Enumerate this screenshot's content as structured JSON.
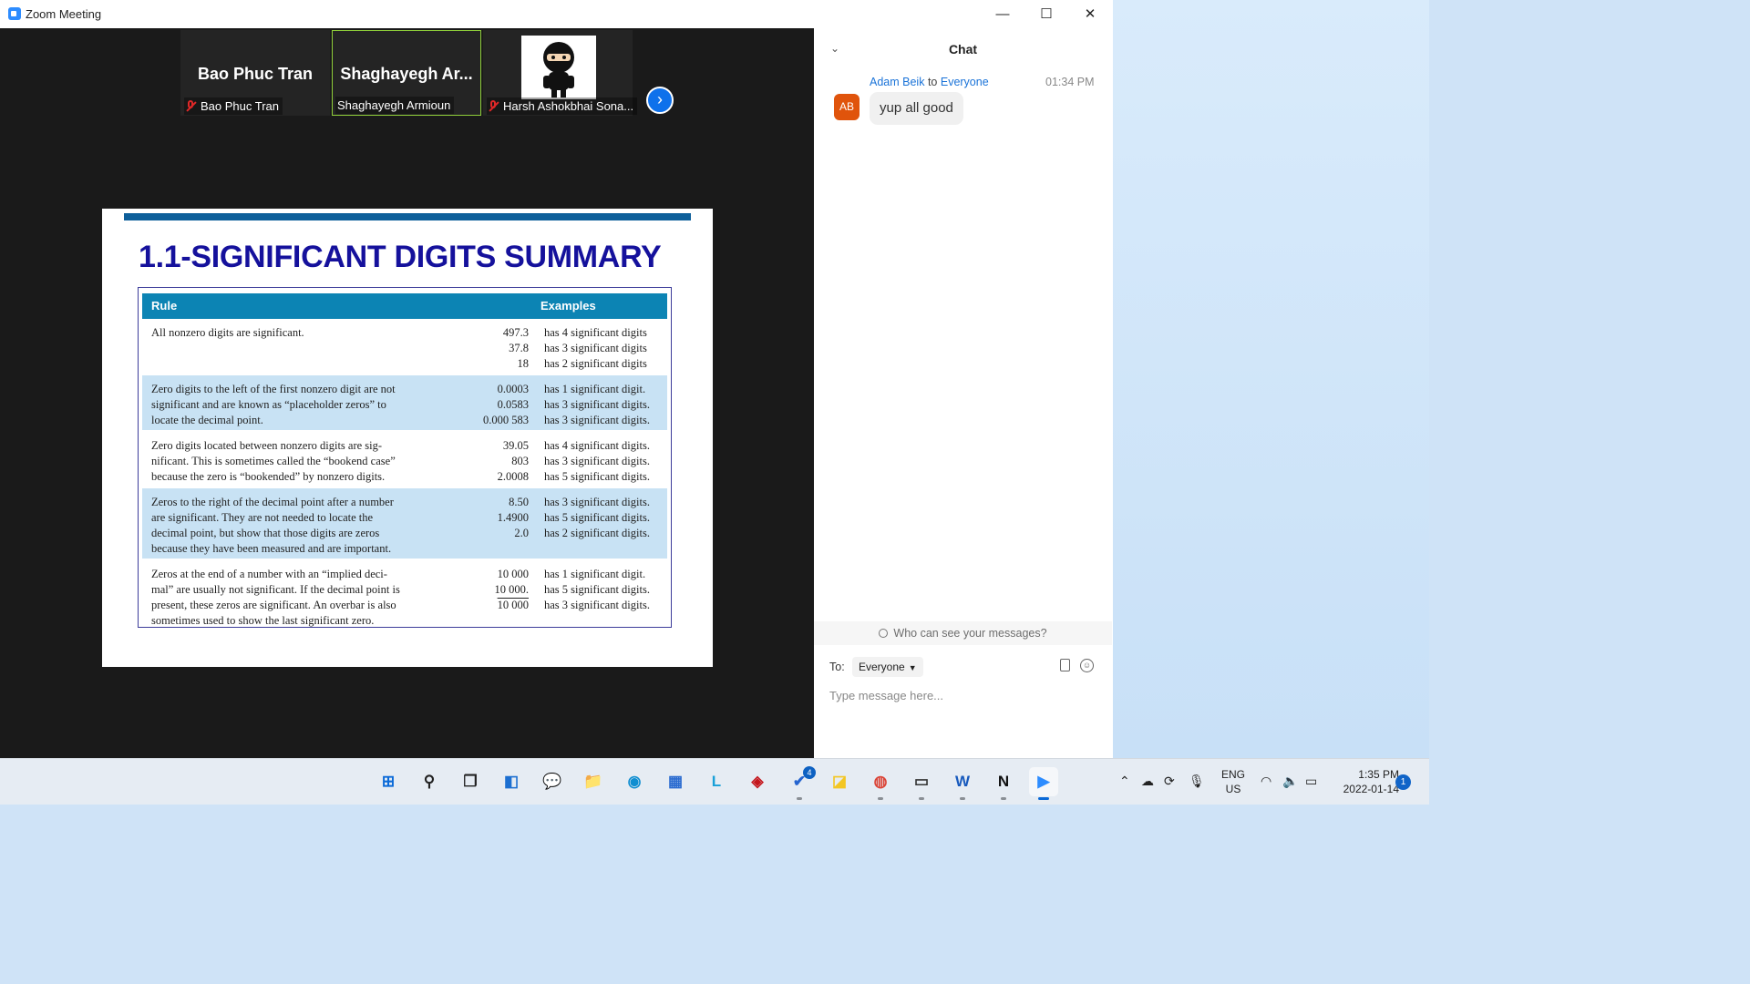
{
  "window": {
    "title": "Zoom Meeting",
    "controls": {
      "minimize": "—",
      "maximize": "☐",
      "close": "✕"
    }
  },
  "participants": [
    {
      "display": "Bao Phuc Tran",
      "name": "Bao Phuc Tran",
      "muted": true
    },
    {
      "display": "Shaghayegh  Ar...",
      "name": "Shaghayegh Armioun",
      "muted": false
    },
    {
      "display": "",
      "name": "Harsh Ashokbhai Sona...",
      "muted": true,
      "avatar": "ninja-avatar"
    }
  ],
  "next_icon": "›",
  "slide": {
    "title": "1.1-SIGNIFICANT DIGITS SUMMARY",
    "headers": {
      "rule": "Rule",
      "examples": "Examples"
    },
    "rows": [
      {
        "rule": [
          "All nonzero digits are significant."
        ],
        "nums": [
          "497.3",
          "37.8",
          "18"
        ],
        "examples": [
          "has 4 significant digits",
          "has 3 significant digits",
          "has 2 significant digits"
        ]
      },
      {
        "rule": [
          "Zero digits to the left of the first nonzero digit are not",
          "significant and are known as “placeholder zeros” to",
          "locate the decimal point."
        ],
        "nums": [
          "0.0003",
          "0.0583",
          "0.000 583"
        ],
        "examples": [
          "has 1 significant digit.",
          "has 3 significant digits.",
          "has 3 significant digits."
        ]
      },
      {
        "rule": [
          "Zero digits located between nonzero digits are sig-",
          "nificant. This is sometimes called the “bookend case”",
          "because the zero is “bookended” by nonzero digits."
        ],
        "nums": [
          "39.05",
          "803",
          "2.0008"
        ],
        "examples": [
          "has 4 significant digits.",
          "has 3 significant digits.",
          "has 5 significant digits."
        ]
      },
      {
        "rule": [
          "Zeros to the right of the decimal point after a number",
          "are significant. They are not needed to locate the",
          "decimal point, but show that those digits are zeros",
          "because they have been measured and are important."
        ],
        "nums": [
          "8.50",
          "1.4900",
          "2.0"
        ],
        "examples": [
          "has 3 significant digits.",
          "has 5 significant digits.",
          "has 2 significant digits."
        ]
      },
      {
        "rule": [
          "Zeros at the end of a number with an “implied deci-",
          "mal” are usually not significant. If the decimal point is",
          "present, these zeros are significant. An overbar is also",
          "sometimes used to show the last significant zero."
        ],
        "nums": [
          "10 000",
          "10 000.",
          "10 000"
        ],
        "examples": [
          "has 1 significant digit.",
          "has 5 significant digits.",
          "has 3 significant digits."
        ]
      }
    ]
  },
  "chat": {
    "title": "Chat",
    "collapse_icon": "⌄",
    "message": {
      "initials": "AB",
      "sender": "Adam Beik",
      "to_word": "to",
      "recipient": "Everyone",
      "time": "01:34 PM",
      "text": "yup all good"
    },
    "who_can_see": "Who can see your messages?",
    "to_label": "To:",
    "to_value": "Everyone",
    "input_placeholder": "Type message here..."
  },
  "taskbar": {
    "apps": [
      {
        "name": "windows-start-icon",
        "glyph": "⊞",
        "color": "#0b6ad8"
      },
      {
        "name": "search-icon",
        "glyph": "⚲",
        "color": "#222"
      },
      {
        "name": "task-view-icon",
        "glyph": "❐",
        "color": "#222"
      },
      {
        "name": "widgets-icon",
        "glyph": "◧",
        "color": "#1c6fd1"
      },
      {
        "name": "teams-chat-icon",
        "glyph": "💬",
        "color": "#5b5fc7"
      },
      {
        "name": "file-explorer-icon",
        "glyph": "📁",
        "color": "#e8b017"
      },
      {
        "name": "edge-icon",
        "glyph": "◉",
        "color": "#0f8ed1"
      },
      {
        "name": "store-icon",
        "glyph": "▦",
        "color": "#2a6bd0"
      },
      {
        "name": "l-app-icon",
        "glyph": "L",
        "color": "#19a0d8"
      },
      {
        "name": "mcafee-icon",
        "glyph": "◈",
        "color": "#c4161c"
      },
      {
        "name": "todo-icon",
        "glyph": "✔",
        "color": "#2564cf",
        "badge": "4"
      },
      {
        "name": "sticky-notes-icon",
        "glyph": "◪",
        "color": "#f3c623"
      },
      {
        "name": "chrome-icon",
        "glyph": "◍",
        "color": "#db4437"
      },
      {
        "name": "terminal-icon",
        "glyph": "▭",
        "color": "#333"
      },
      {
        "name": "word-icon",
        "glyph": "W",
        "color": "#185abd"
      },
      {
        "name": "notion-icon",
        "glyph": "N",
        "color": "#111"
      },
      {
        "name": "zoom-icon",
        "glyph": "▶",
        "color": "#2d8cff"
      }
    ],
    "lang_line1": "ENG",
    "lang_line2": "US",
    "time": "1:35 PM",
    "date": "2022-01-14",
    "notifications": "1"
  }
}
